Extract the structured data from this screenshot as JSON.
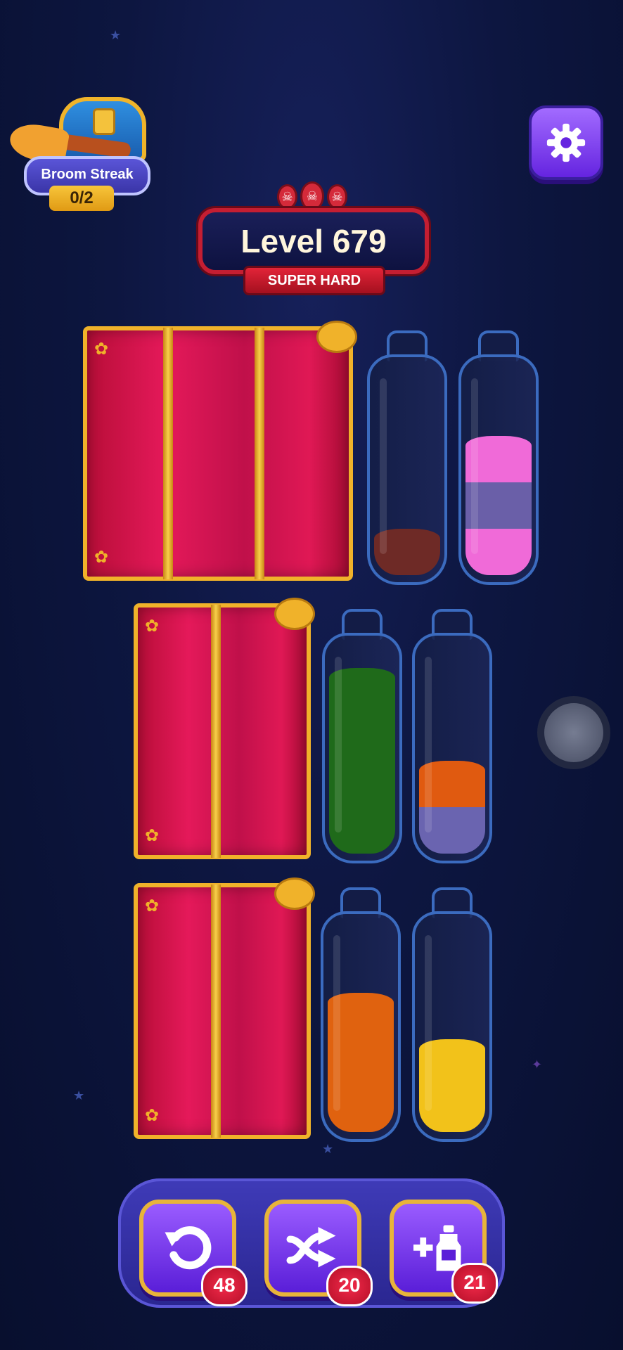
{
  "streak": {
    "label": "Broom Streak",
    "count": "0/2"
  },
  "level": {
    "title": "Level 679",
    "difficulty": "SUPER HARD"
  },
  "bottles": [
    {
      "row": 1,
      "layers": [
        "#6e2a26"
      ]
    },
    {
      "row": 1,
      "layers": [
        "#f06ad8",
        "#6a5fa8",
        "#f06ad8"
      ]
    },
    {
      "row": 2,
      "layers": [
        "#1f6a1a",
        "#1f6a1a",
        "#1f6a1a",
        "#1f6a1a"
      ]
    },
    {
      "row": 2,
      "layers": [
        "#6a64b0",
        "#e05a10"
      ]
    },
    {
      "row": 3,
      "layers": [
        "#e0620f",
        "#e0620f",
        "#e0620f"
      ]
    },
    {
      "row": 3,
      "layers": [
        "#f2c21a",
        "#f2c21a"
      ]
    }
  ],
  "actions": {
    "undo_count": "48",
    "swap_count": "20",
    "add_bottle_count": "21"
  }
}
